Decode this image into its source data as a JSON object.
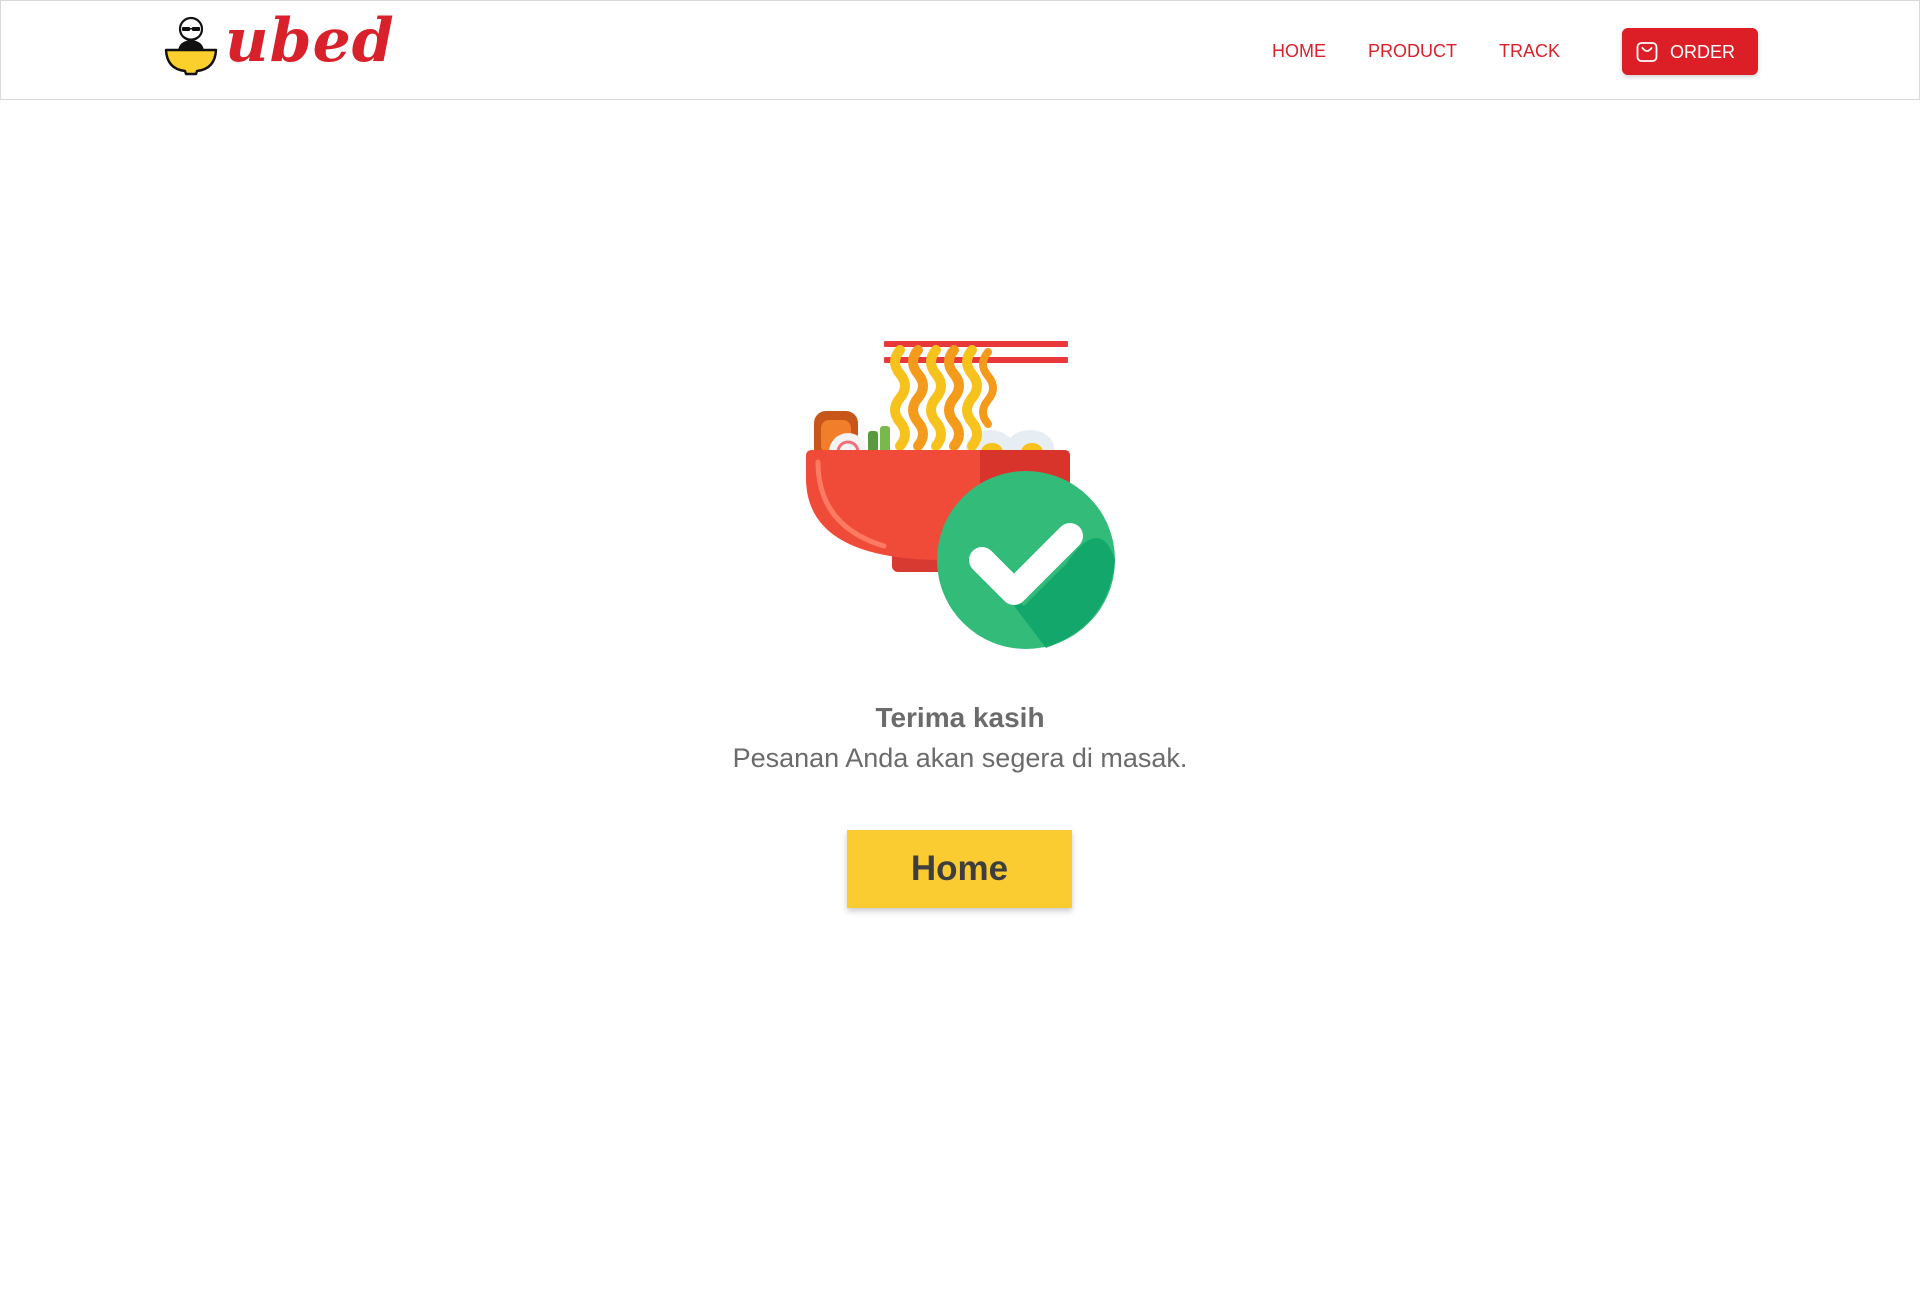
{
  "brand": {
    "name": "ubed",
    "color": "#d9212b"
  },
  "nav": {
    "items": [
      {
        "label": "HOME"
      },
      {
        "label": "PRODUCT"
      },
      {
        "label": "TRACK"
      }
    ],
    "order_label": "ORDER",
    "order_icon": "shopping-bag-icon",
    "order_color": "#dc1f26"
  },
  "main": {
    "illustration": "ramen-bowl-with-checkmark",
    "title": "Terima kasih",
    "subtitle": "Pesanan Anda akan segera di masak.",
    "home_button_label": "Home",
    "home_button_color": "#fbcc31",
    "check_color": "#33bb7a"
  }
}
